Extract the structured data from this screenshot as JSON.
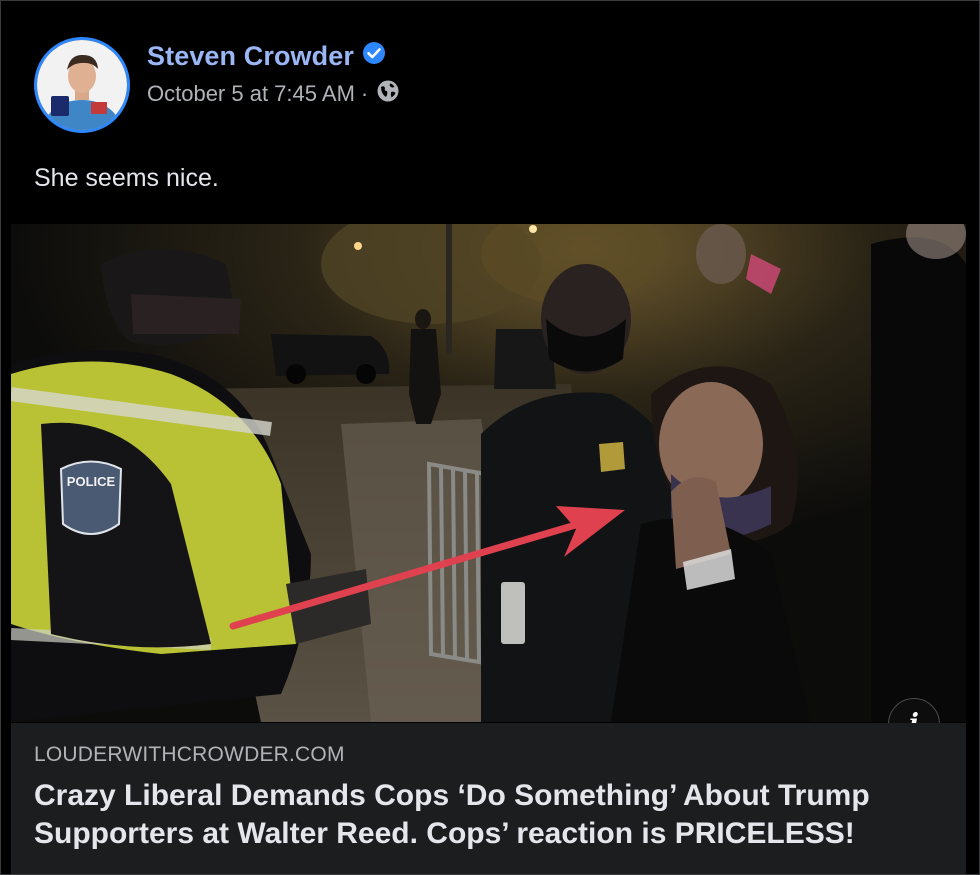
{
  "post": {
    "author": "Steven Crowder",
    "timestamp": "October 5 at 7:45 AM",
    "separator": "·",
    "text": "She seems nice.",
    "verified_icon": "verified-badge-icon",
    "privacy_icon": "globe-icon"
  },
  "link_preview": {
    "domain": "LOUDERWITHCROWDER.COM",
    "headline_line1": "Crazy Liberal Demands Cops ‘Do Something’ About Trump",
    "headline_line2": "Supporters at Walter Reed. Cops’ reaction is PRICELESS!",
    "info_label": "i",
    "patch_text": "POLICE"
  },
  "colors": {
    "accent_blue": "#2d88ff",
    "arrow_red": "#e0414e",
    "vest_yellow": "#c9d43a"
  }
}
